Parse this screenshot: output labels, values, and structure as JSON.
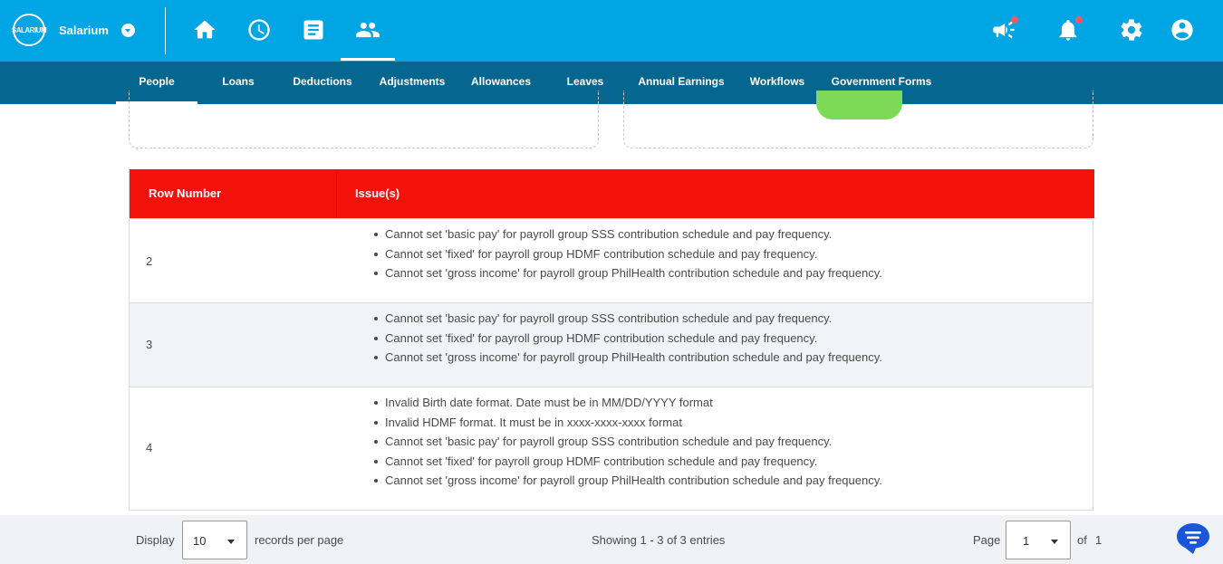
{
  "brand": {
    "logo_text": "SALARIUM",
    "name": "Salarium"
  },
  "top_nav": {
    "icons": [
      "home-icon",
      "clock-icon",
      "document-icon",
      "people-icon"
    ],
    "active": "people-icon"
  },
  "top_right": {
    "icons": [
      "megaphone-icon",
      "bell-icon",
      "gear-icon",
      "account-icon"
    ]
  },
  "tabs": [
    {
      "label": "People",
      "active": true
    },
    {
      "label": "Loans"
    },
    {
      "label": "Deductions"
    },
    {
      "label": "Adjustments"
    },
    {
      "label": "Allowances"
    },
    {
      "label": "Leaves"
    },
    {
      "label": "Annual Earnings"
    },
    {
      "label": "Workflows"
    },
    {
      "label": "Government Forms"
    }
  ],
  "table": {
    "headers": [
      "Row Number",
      "Issue(s)"
    ],
    "rows": [
      {
        "row": "2",
        "issues": [
          "Cannot set 'basic pay' for payroll group SSS contribution schedule and pay frequency.",
          "Cannot set 'fixed' for payroll group HDMF contribution schedule and pay frequency.",
          "Cannot set 'gross income' for payroll group PhilHealth contribution schedule and pay frequency."
        ]
      },
      {
        "row": "3",
        "issues": [
          "Cannot set 'basic pay' for payroll group SSS contribution schedule and pay frequency.",
          "Cannot set 'fixed' for payroll group HDMF contribution schedule and pay frequency.",
          "Cannot set 'gross income' for payroll group PhilHealth contribution schedule and pay frequency."
        ]
      },
      {
        "row": "4",
        "issues": [
          "Invalid Birth date format. Date must be in MM/DD/YYYY format",
          "Invalid HDMF format. It must be in xxxx-xxxx-xxxx format",
          "Cannot set 'basic pay' for payroll group SSS contribution schedule and pay frequency.",
          "Cannot set 'fixed' for payroll group HDMF contribution schedule and pay frequency.",
          "Cannot set 'gross income' for payroll group PhilHealth contribution schedule and pay frequency."
        ]
      }
    ]
  },
  "footer": {
    "display_label": "Display",
    "per_page_value": "10",
    "records_label": "records per page",
    "showing": "Showing 1 - 3 of 3 entries",
    "page_label": "Page",
    "page_value": "1",
    "of_label": "of",
    "total_pages": "1"
  },
  "colors": {
    "topbar": "#00a5e3",
    "subnav": "#05668f",
    "table_header": "#f21209",
    "notification_dot": "#f05a6a",
    "chat_button": "#1a56db"
  }
}
